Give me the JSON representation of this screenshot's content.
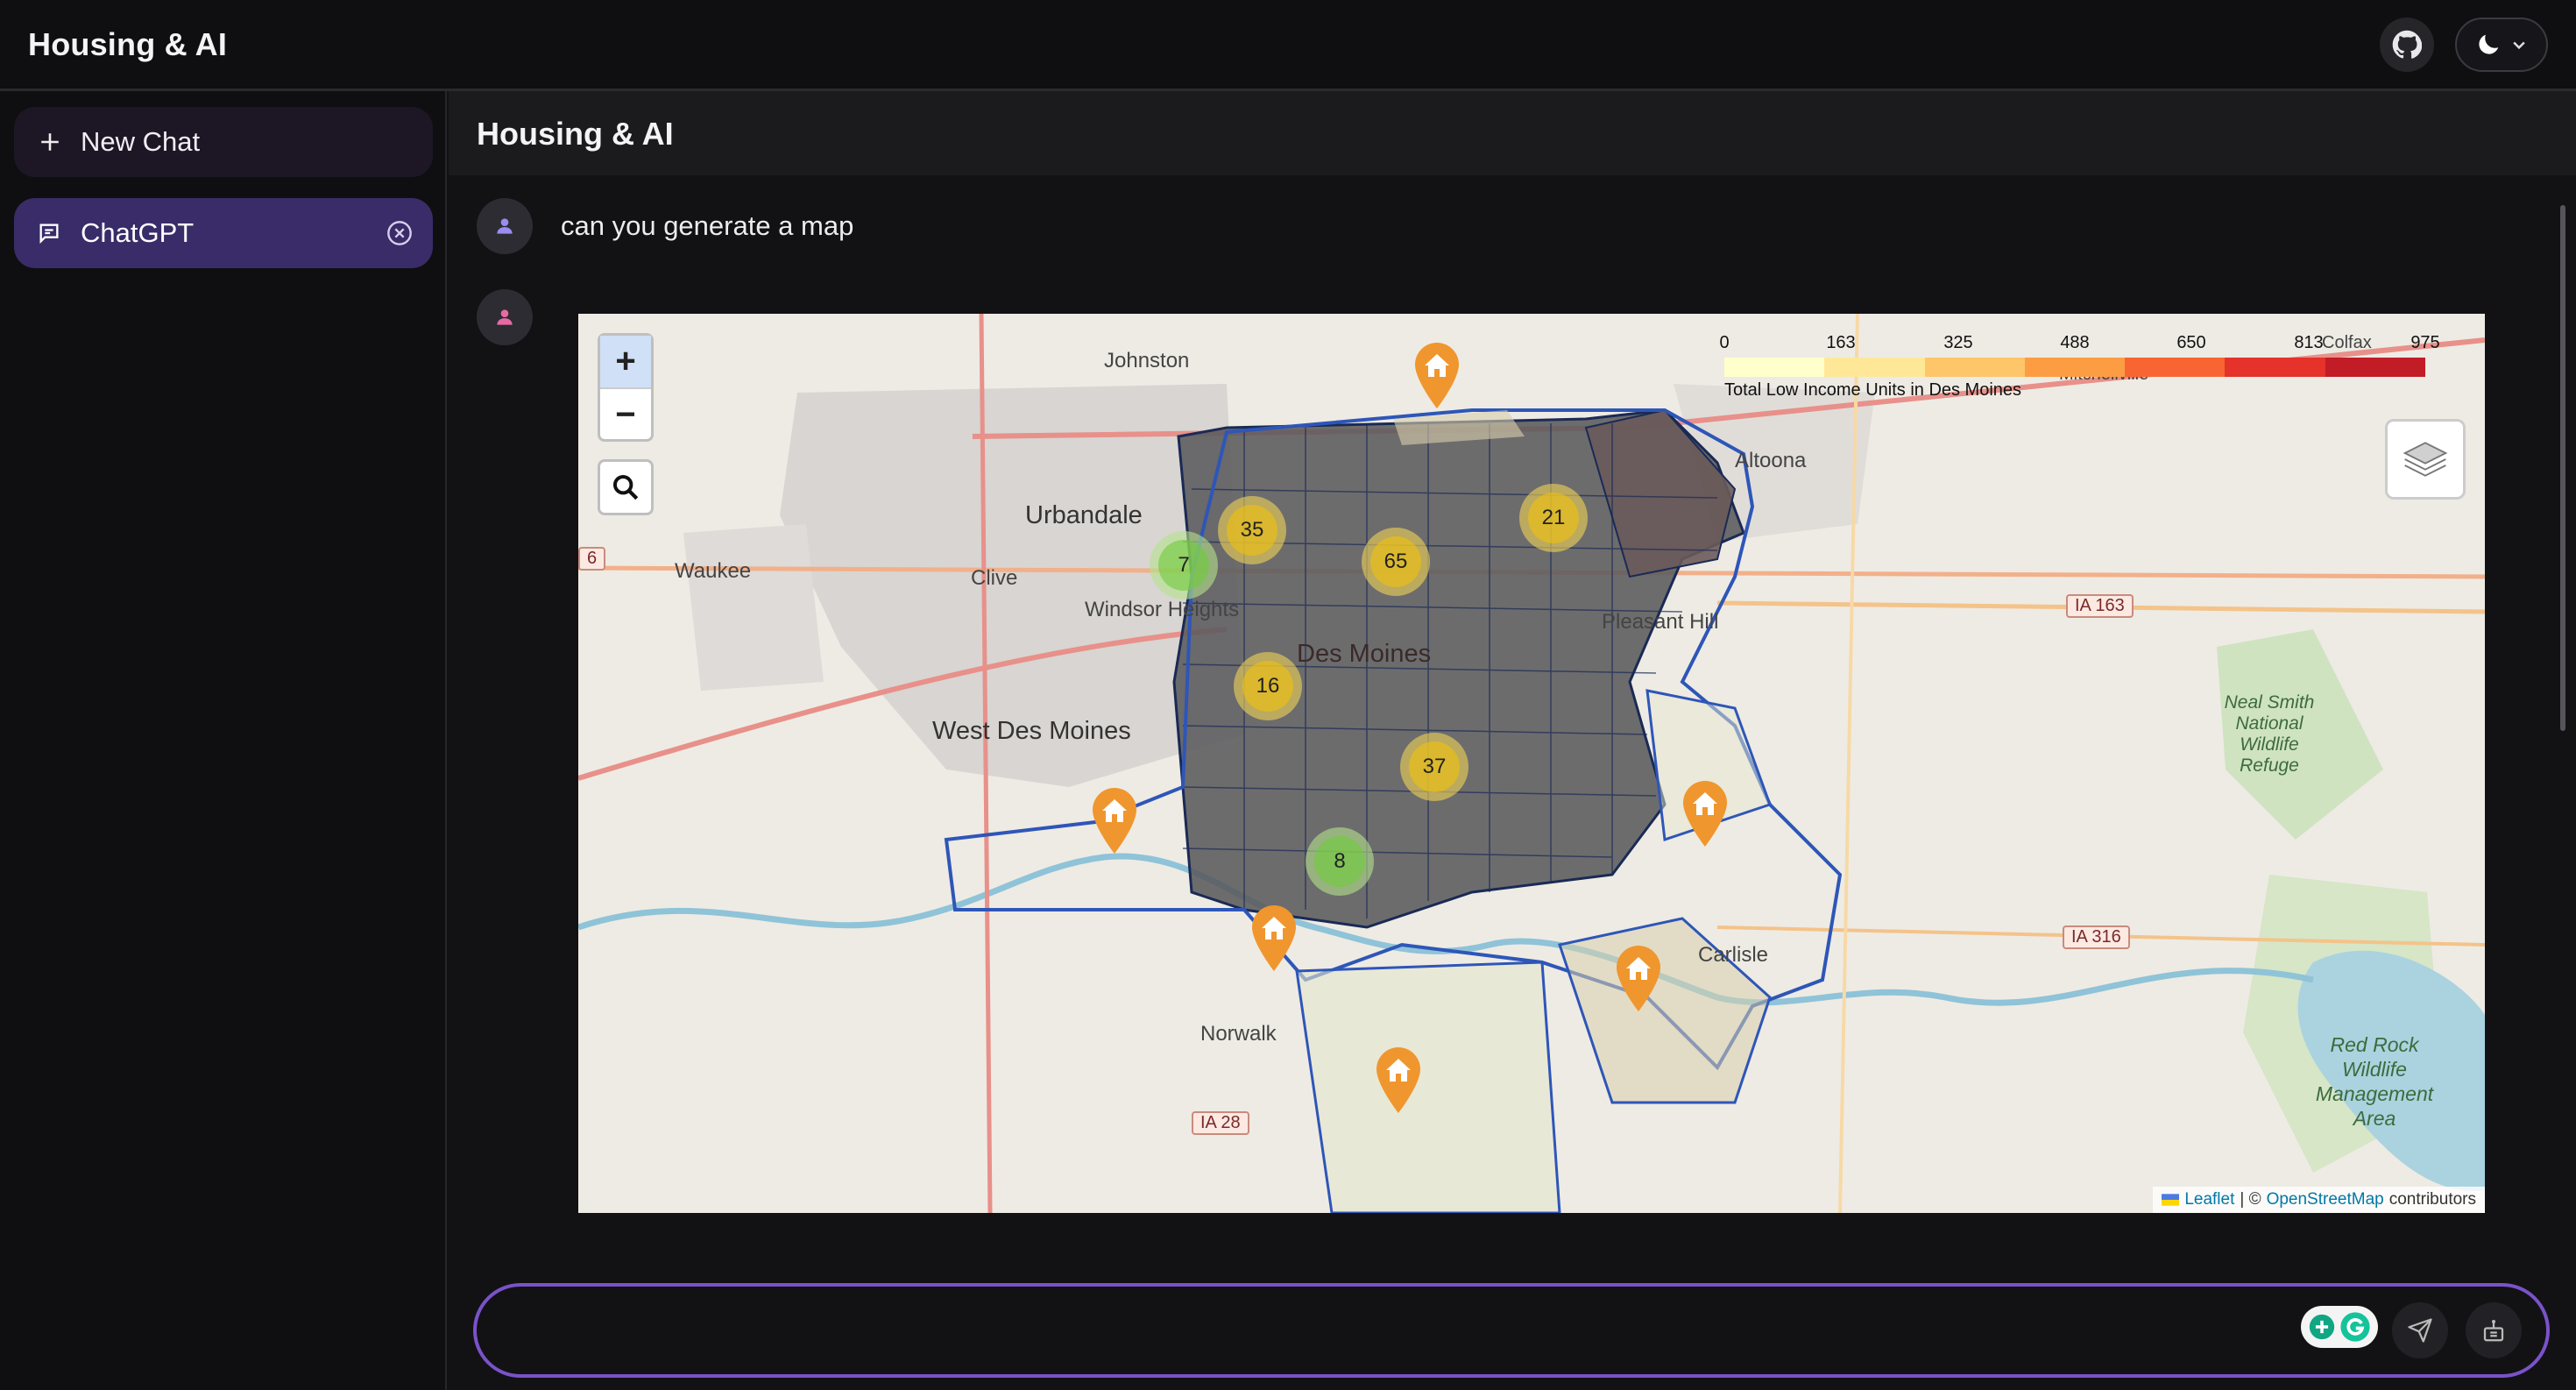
{
  "app": {
    "title": "Housing & AI"
  },
  "topbar": {
    "github_icon": "github-icon",
    "theme_icon": "moon-icon",
    "theme_chevron": "chevron-down-icon"
  },
  "sidebar": {
    "new_chat_label": "New Chat",
    "items": [
      {
        "label": "ChatGPT",
        "icon": "message-square-icon",
        "close_icon": "close-circle-icon",
        "active": true
      }
    ]
  },
  "main": {
    "title": "Housing & AI",
    "messages": [
      {
        "role": "user",
        "text": "can you generate a map"
      },
      {
        "role": "assistant",
        "content": "map"
      }
    ]
  },
  "map": {
    "zoom_in": "+",
    "zoom_out": "−",
    "legend": {
      "ticks": [
        "0",
        "163",
        "325",
        "488",
        "650",
        "813",
        "975"
      ],
      "caption": "Total Low Income Units in Des Moines",
      "colors": [
        "#ffffcc",
        "#fee898",
        "#fec569",
        "#fd9d43",
        "#f86532",
        "#e5322a",
        "#c21c26"
      ]
    },
    "clusters": [
      {
        "count": "7",
        "level": "green"
      },
      {
        "count": "35",
        "level": "yellow"
      },
      {
        "count": "65",
        "level": "yellow"
      },
      {
        "count": "21",
        "level": "yellow"
      },
      {
        "count": "16",
        "level": "yellow"
      },
      {
        "count": "37",
        "level": "yellow"
      },
      {
        "count": "8",
        "level": "green"
      }
    ],
    "places": {
      "johnston": "Johnston",
      "urbandale": "Urbandale",
      "waukee": "Waukee",
      "clive": "Clive",
      "windsor": "Windsor Heights",
      "wdm": "West Des Moines",
      "dsm": "Des Moines",
      "altoona": "Altoona",
      "pleasant_hill": "Pleasant Hill",
      "carlisle": "Carlisle",
      "norwalk": "Norwalk",
      "mitchellville": "Mitchellville",
      "colfax": "Colfax",
      "neal_smith": "Neal Smith National Wildlife Refuge",
      "red_rock": "Red Rock Wildlife Management Area"
    },
    "shields": {
      "ia163": "IA 163",
      "ia316": "IA 316",
      "ia28": "IA 28",
      "six": "6"
    },
    "attribution": {
      "leaflet": "Leaflet",
      "sep": "| ©",
      "osm": "OpenStreetMap",
      "suffix": "contributors"
    }
  },
  "input": {
    "value": "",
    "placeholder": "",
    "send_icon": "send-icon",
    "tool_icon": "tool-icon"
  },
  "colors": {
    "accent": "#7a52c9",
    "sidebar_active": "#3a2c68",
    "map_outline": "#2e56b8"
  }
}
